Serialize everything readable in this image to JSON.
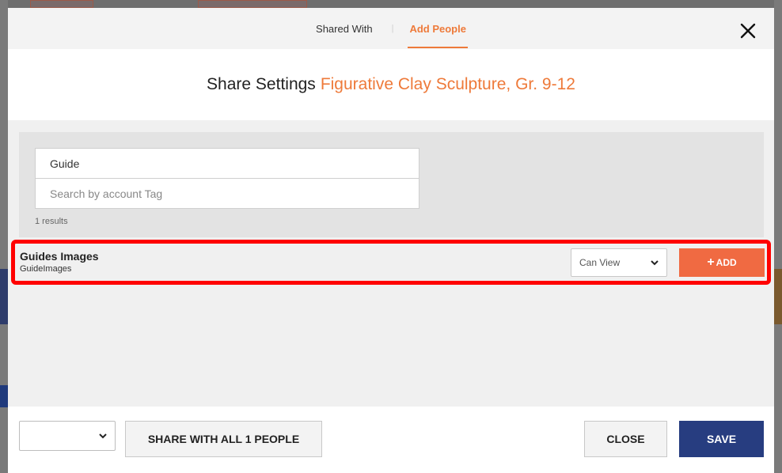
{
  "header": {
    "tabs": [
      {
        "label": "Shared With",
        "active": false
      },
      {
        "label": "Add People",
        "active": true
      }
    ],
    "separator": "|",
    "close_icon": "close-icon"
  },
  "title": {
    "prefix": "Share Settings",
    "name": "Figurative Clay Sculpture, Gr. 9-12"
  },
  "search": {
    "value": "Guide",
    "tag_placeholder": "Search by account Tag",
    "results_count": "1 results"
  },
  "results": [
    {
      "name": "Guides Images",
      "tag": "GuideImages",
      "permission": "Can View",
      "add_label": "ADD",
      "add_icon": "plus-icon"
    }
  ],
  "footer": {
    "select_value": "",
    "share_all_label": "SHARE WITH ALL 1 PEOPLE",
    "close_label": "CLOSE",
    "save_label": "SAVE"
  },
  "colors": {
    "accent": "#ee7a3a",
    "add_button": "#f06a42",
    "save_button": "#273d80",
    "highlight_border": "#ff0000"
  }
}
